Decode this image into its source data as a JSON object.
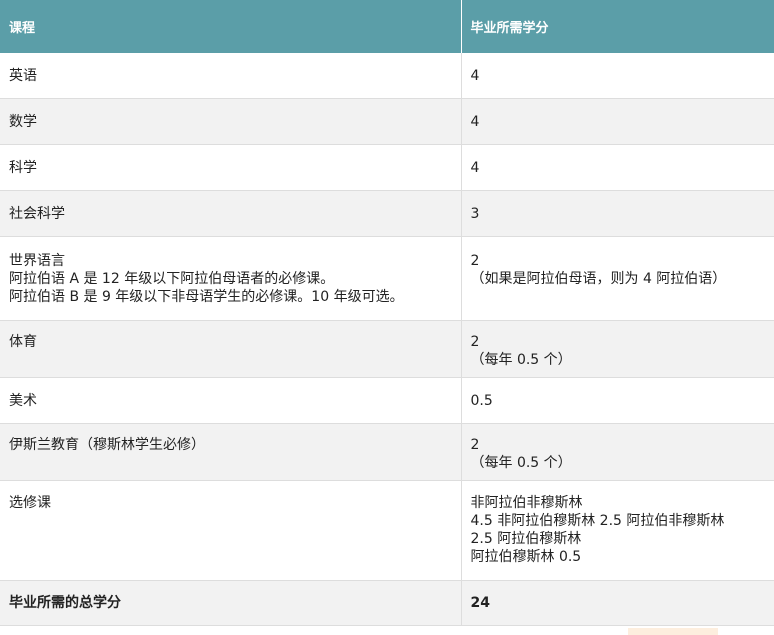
{
  "table": {
    "headers": [
      "课程",
      "毕业所需学分"
    ],
    "rows": [
      {
        "course": [
          "英语"
        ],
        "credits": [
          "4"
        ]
      },
      {
        "course": [
          "数学"
        ],
        "credits": [
          "4"
        ]
      },
      {
        "course": [
          "科学"
        ],
        "credits": [
          "4"
        ]
      },
      {
        "course": [
          "社会科学"
        ],
        "credits": [
          "3"
        ]
      },
      {
        "course": [
          "世界语言",
          "阿拉伯语 A 是 12 年级以下阿拉伯母语者的必修课。",
          "阿拉伯语 B 是 9 年级以下非母语学生的必修课。10 年级可选。"
        ],
        "credits": [
          "2",
          "（如果是阿拉伯母语，则为 4 阿拉伯语）"
        ]
      },
      {
        "course": [
          "体育"
        ],
        "credits": [
          "2",
          "（每年 0.5 个）"
        ]
      },
      {
        "course": [
          "美术"
        ],
        "credits": [
          "0.5"
        ]
      },
      {
        "course": [
          "伊斯兰教育（穆斯林学生必修）"
        ],
        "credits": [
          "2",
          "（每年 0.5 个）"
        ]
      },
      {
        "course": [
          "选修课"
        ],
        "credits": [
          "非阿拉伯非穆斯林",
          "4.5 非阿拉伯穆斯林 2.5 阿拉伯非穆斯林",
          "2.5 阿拉伯穆斯林",
          "阿拉伯穆斯林 0.5"
        ]
      }
    ],
    "total": {
      "label": "毕业所需的总学分",
      "value": "24"
    }
  }
}
